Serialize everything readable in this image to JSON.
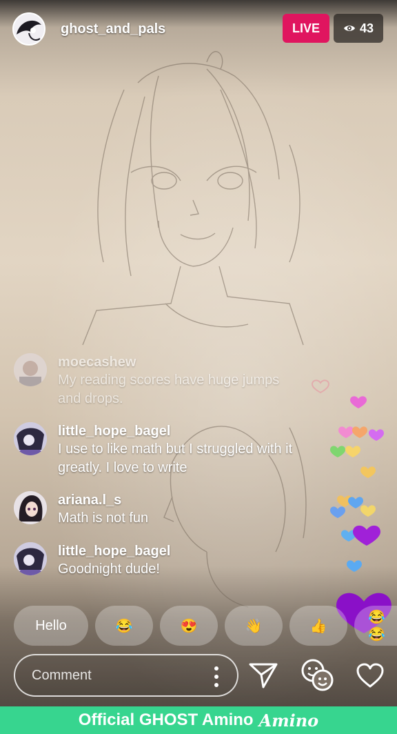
{
  "header": {
    "host_name": "ghost_and_pals",
    "live_label": "LIVE",
    "viewer_count": "43",
    "viewer_icon": "eye-icon"
  },
  "chat": {
    "messages": [
      {
        "user": "moecashew",
        "lines": [
          "My reading scores have huge jumps",
          "and drops."
        ]
      },
      {
        "user": "little_hope_bagel",
        "lines": [
          "I use to like math but I struggled with it",
          "greatly. I love to write"
        ]
      },
      {
        "user": "ariana.l_s",
        "lines": [
          "Math is not fun"
        ]
      },
      {
        "user": "little_hope_bagel",
        "lines": [
          "Goodnight dude!"
        ]
      }
    ]
  },
  "quick_replies": {
    "hello": "Hello",
    "emoji1": "😂",
    "emoji2": "😍",
    "emoji3": "👋",
    "emoji4": "👍",
    "emoji5": "😂😂"
  },
  "comment": {
    "placeholder": "Comment"
  },
  "actions": {
    "send_icon": "send-icon",
    "stickers_icon": "stickers-icon",
    "like_icon": "heart-icon"
  },
  "footer": {
    "community": "Official GHOST Amino",
    "brand": "Amino"
  },
  "colors": {
    "live": "#e0155f",
    "footer": "#37d58f",
    "heart_big": "#8a10c8"
  }
}
